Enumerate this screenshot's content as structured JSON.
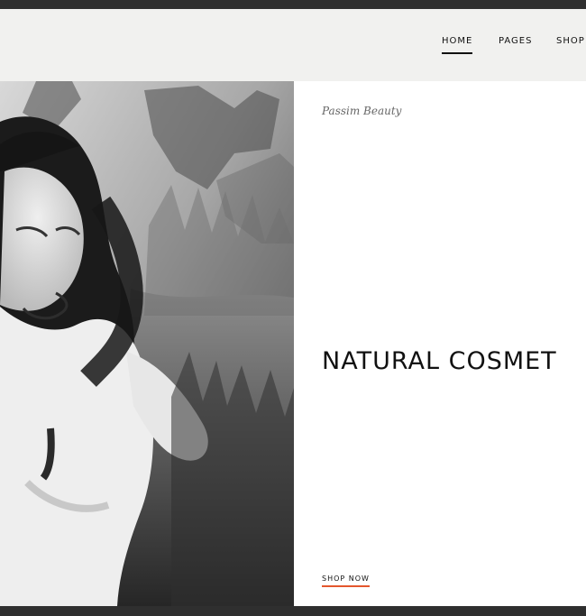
{
  "nav": {
    "items": [
      {
        "label": "HOME",
        "active": true
      },
      {
        "label": "PAGES",
        "active": false
      },
      {
        "label": "SHOP",
        "active": false
      }
    ]
  },
  "hero": {
    "eyebrow": "Passim Beauty",
    "headline": "NATURAL COSMET",
    "cta": "SHOP NOW",
    "image_alt": "black-and-white-photo-of-smiling-woman"
  },
  "colors": {
    "frame": "#2f2f2f",
    "header_bg": "#f1f1ef",
    "text": "#111111",
    "accent": "#e4572e"
  }
}
